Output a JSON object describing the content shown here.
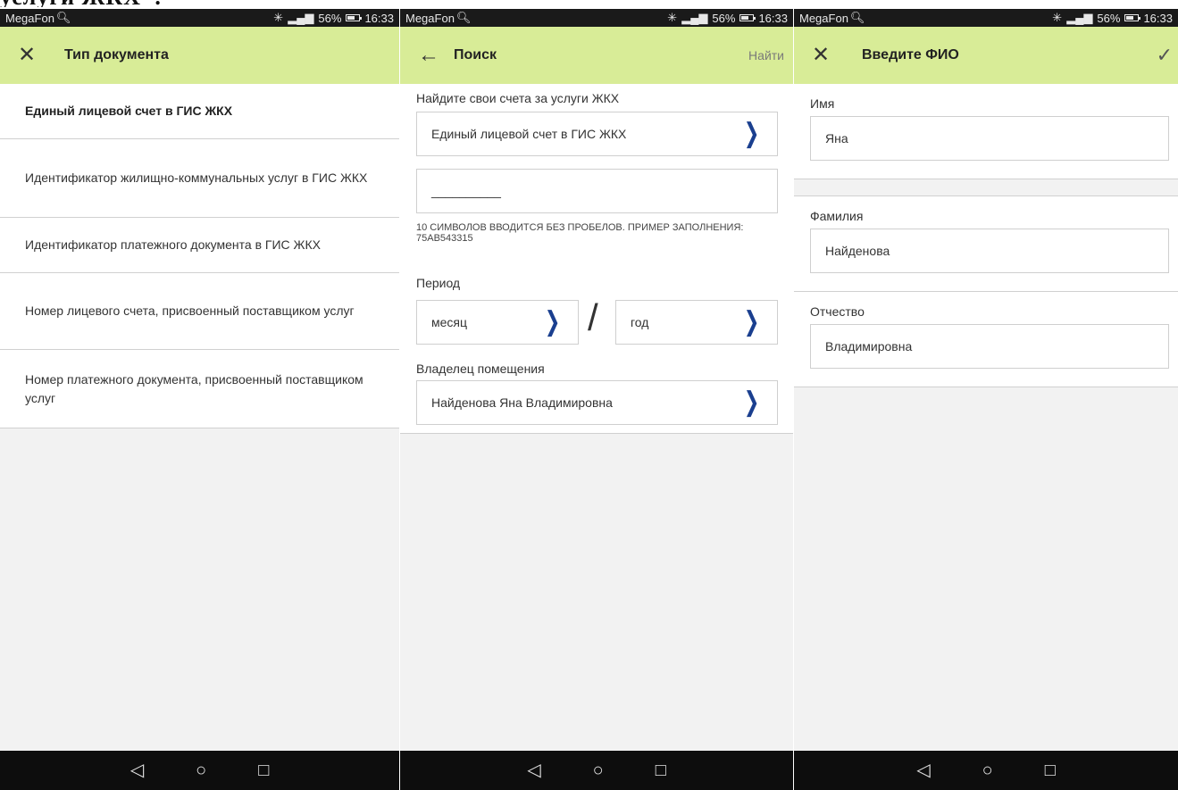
{
  "heading_fragment": "услуги ЖКХ\".",
  "status": {
    "carrier": "MegaFon",
    "battery": "56%",
    "time": "16:33",
    "signal": "4G"
  },
  "screen1": {
    "title": "Тип документа",
    "items": [
      "Единый лицевой счет в ГИС ЖКХ",
      "Идентификатор жилищно-коммунальных услуг в ГИС ЖКХ",
      "Идентификатор платежного документа в ГИС ЖКХ",
      "Номер лицевого счета, присвоенный поставщиком услуг",
      "Номер платежного документа, присвоенный поставщиком услуг"
    ]
  },
  "screen2": {
    "title": "Поиск",
    "action": "Найти",
    "section_label": "Найдите свои счета за услуги ЖКХ",
    "doc_type_value": "Единый лицевой счет в ГИС ЖКХ",
    "number_value": "__________",
    "hint": "10 СИМВОЛОВ ВВОДИТСЯ БЕЗ ПРОБЕЛОВ. ПРИМЕР ЗАПОЛНЕНИЯ: 75AB543315",
    "period_label": "Период",
    "month_value": "месяц",
    "separator": "/",
    "year_value": "год",
    "owner_label": "Владелец помещения",
    "owner_value": "Найденова Яна Владимировна"
  },
  "screen3": {
    "title": "Введите ФИО",
    "first_name_label": "Имя",
    "first_name_value": "Яна",
    "last_name_label": "Фамилия",
    "last_name_value": "Найденова",
    "patronymic_label": "Отчество",
    "patronymic_value": "Владимировна"
  },
  "icons": {
    "close": "close-icon",
    "back": "back-arrow-icon",
    "chevron": "chevron-right-icon",
    "check": "check-icon",
    "nav_back": "nav-back-icon",
    "nav_home": "nav-home-icon",
    "nav_recents": "nav-recents-icon"
  },
  "colors": {
    "appbar": "#d8ec97",
    "chevron": "#1a3f8f",
    "statusbar": "#1a1a1a"
  }
}
